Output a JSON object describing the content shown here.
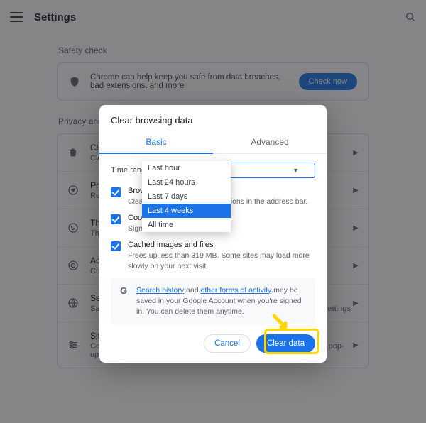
{
  "topbar": {
    "title": "Settings"
  },
  "safety": {
    "section_label": "Safety check",
    "message": "Chrome can help keep you safe from data breaches, bad extensions, and more",
    "button": "Check now"
  },
  "privacy": {
    "section_label": "Privacy and security",
    "items": [
      {
        "title": "Clear browsing data",
        "subtitle": "Clears history, cookies, cache, and more"
      },
      {
        "title": "Privacy Guide",
        "subtitle": "Review Chrome's key privacy and security controls"
      },
      {
        "title": "Third-party cookies",
        "subtitle": "Third-party cookies are blocked in Incognito mode"
      },
      {
        "title": "Ad privacy",
        "subtitle": "Customize the info used by sites to show you ads"
      },
      {
        "title": "Security",
        "subtitle": "Safe Browsing (protection from dangerous sites) and other security settings"
      },
      {
        "title": "Site settings",
        "subtitle": "Controls what information sites can use and show (location, camera, pop-ups, and more)"
      }
    ]
  },
  "dialog": {
    "title": "Clear browsing data",
    "tabs": {
      "basic": "Basic",
      "advanced": "Advanced"
    },
    "time_range_label": "Time range",
    "time_range_value": "Last hour",
    "time_range_options": [
      "Last hour",
      "Last 24 hours",
      "Last 7 days",
      "Last 4 weeks",
      "All time"
    ],
    "time_range_highlight": "Last 4 weeks",
    "rows": {
      "history": {
        "title": "Browsing history",
        "subtitle": "Clears history and autocompletions in the address bar."
      },
      "cookies": {
        "title": "Cookies and other site data",
        "subtitle": "Signs you out of most sites"
      },
      "cache": {
        "title": "Cached images and files",
        "subtitle": "Frees up less than 319 MB. Some sites may load more slowly on your next visit."
      }
    },
    "info": {
      "link1": "Search history",
      "mid": " and ",
      "link2": "other forms of activity",
      "rest": " may be saved in your Google Account when you're signed in. You can delete them anytime."
    },
    "cancel": "Cancel",
    "clear": "Clear data"
  }
}
